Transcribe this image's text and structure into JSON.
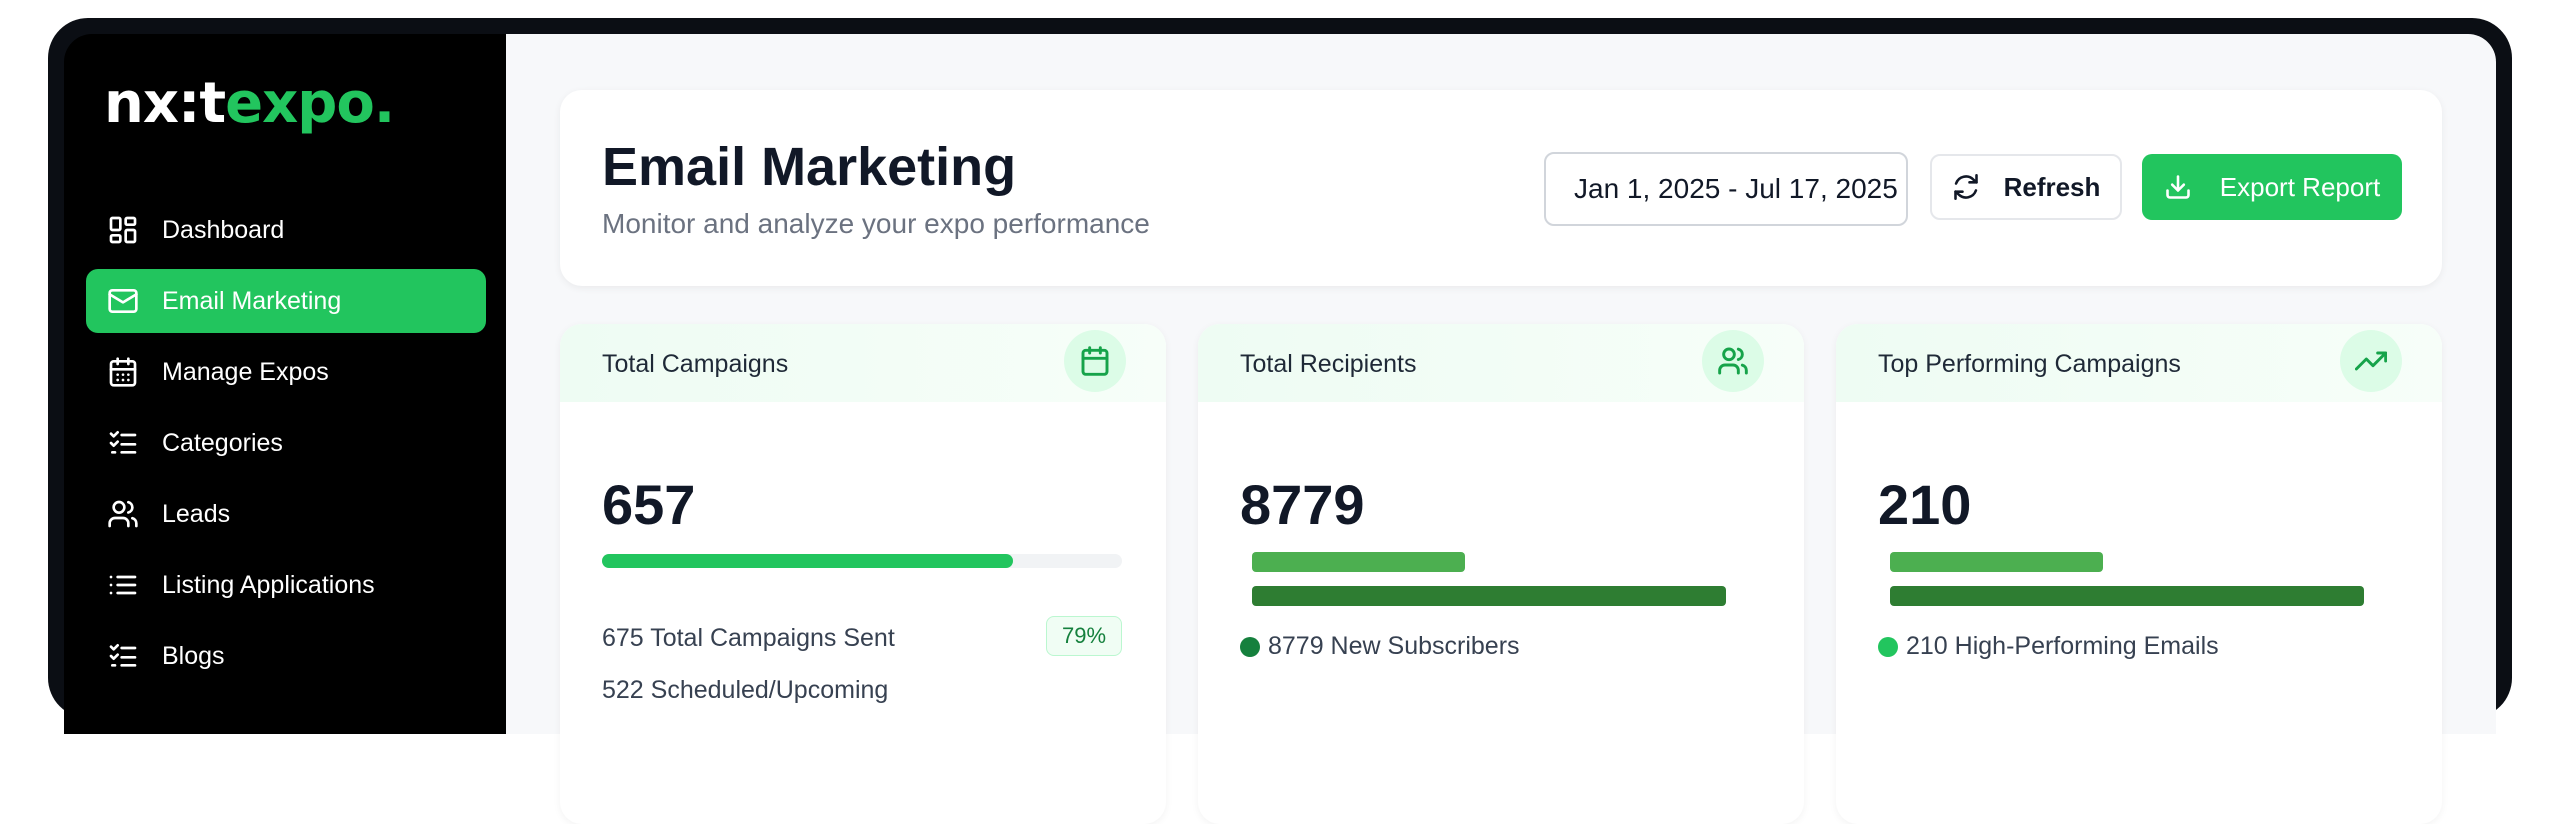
{
  "brand": {
    "logo_white": "nx:t",
    "logo_green": "expo."
  },
  "sidebar": {
    "items": [
      {
        "label": "Dashboard",
        "icon": "dashboard-icon",
        "active": false
      },
      {
        "label": "Email Marketing",
        "icon": "mail-icon",
        "active": true
      },
      {
        "label": "Manage Expos",
        "icon": "calendar-icon",
        "active": false
      },
      {
        "label": "Categories",
        "icon": "checklist-icon",
        "active": false
      },
      {
        "label": "Leads",
        "icon": "users-icon",
        "active": false
      },
      {
        "label": "Listing Applications",
        "icon": "list-icon",
        "active": false
      },
      {
        "label": "Blogs",
        "icon": "checklist-icon",
        "active": false
      }
    ]
  },
  "header": {
    "title": "Email Marketing",
    "subtitle": "Monitor and analyze your expo performance",
    "date_range": "Jan 1, 2025 - Jul 17, 2025",
    "refresh_label": "Refresh",
    "export_label": "Export Report"
  },
  "stats": [
    {
      "title": "Total Campaigns",
      "icon": "calendar-icon",
      "value": "657",
      "progress": 0.79,
      "line1": "675 Total Campaigns Sent",
      "badge": "79%",
      "line2": "522 Scheduled/Upcoming"
    },
    {
      "title": "Total Recipients",
      "icon": "users-icon",
      "value": "8779",
      "bar_short": 0.45,
      "bar_long": 1.0,
      "legend": "8779 New Subscribers"
    },
    {
      "title": "Top Performing Campaigns",
      "icon": "trending-up-icon",
      "value": "210",
      "bar_short": 0.45,
      "bar_long": 1.0,
      "legend": "210 High-Performing Emails"
    }
  ],
  "colors": {
    "accent": "#22c55e",
    "bar_light": "#4caf50",
    "bar_dark": "#2e7d32",
    "dot_dark": "#15803d",
    "dot_light": "#22c55e"
  }
}
